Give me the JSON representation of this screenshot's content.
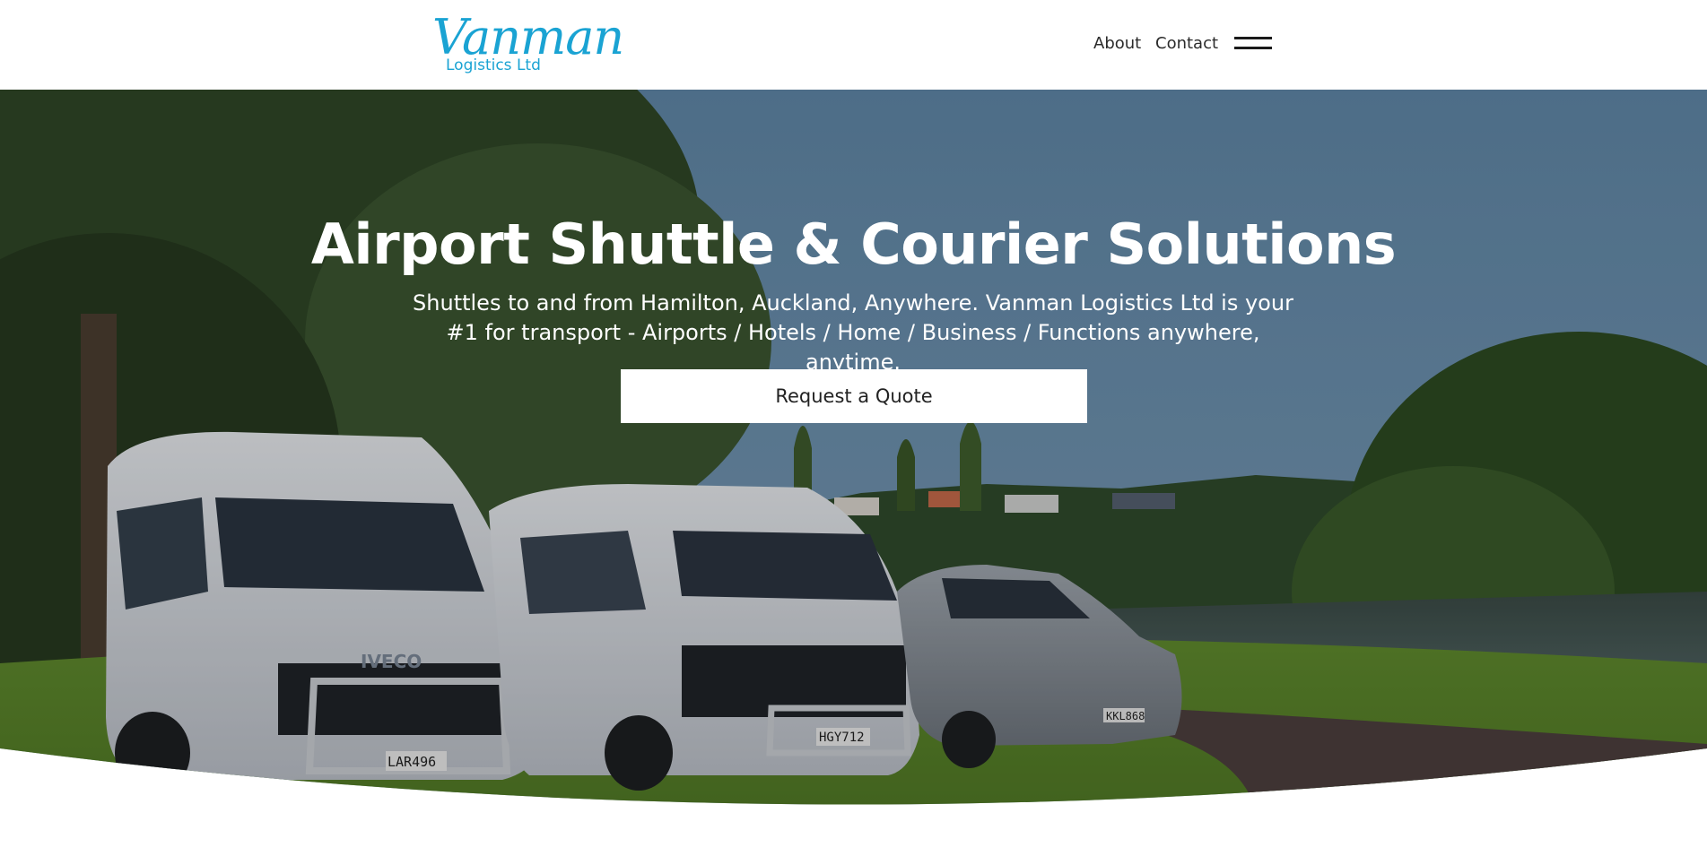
{
  "header": {
    "logo": {
      "main": "Vanman",
      "sub": "Logistics Ltd",
      "color": "#1aa3d3"
    },
    "nav": {
      "about": "About",
      "contact": "Contact",
      "menu_icon": "hamburger-menu-icon"
    }
  },
  "hero": {
    "title": "Airport Shuttle & Courier Solutions",
    "subtitle": "Shuttles to and from Hamilton, Auckland, Anywhere. Vanman Logistics Ltd is your #1 for transport - Airports / Hotels / Home / Business / Functions anywhere, anytime.",
    "cta_label": "Request a Quote",
    "plates": {
      "van_1_brand": "IVECO",
      "van_1_plate": "LAR496",
      "van_2_plate": "HGY712",
      "car_plate": "KKL868"
    }
  }
}
